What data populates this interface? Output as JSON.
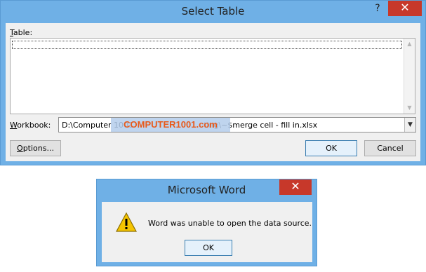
{
  "select_table": {
    "title": "Select Table",
    "help_glyph": "?",
    "close_glyph": "✕",
    "table_label_accel": "T",
    "table_label_rest": "able:",
    "workbook_label_accel": "W",
    "workbook_label_rest": "orkbook:",
    "workbook_value_start": "D:\\Computer 1001",
    "workbook_value_end": "ting\\~$merge cell - fill in.xlsx",
    "watermark": "COMPUTER1001.com",
    "options_label_accel": "O",
    "options_label_rest": "ptions...",
    "ok_label": "OK",
    "cancel_label": "Cancel"
  },
  "word_dialog": {
    "title": "Microsoft Word",
    "close_glyph": "✕",
    "message": "Word was unable to open the data source.",
    "ok_label": "OK"
  },
  "icons": {
    "warning": "warning-icon",
    "scroll_up": "chevron-up-icon",
    "scroll_down": "chevron-down-icon",
    "combo_arrow": "chevron-down-icon"
  },
  "colors": {
    "title_bar": "#6fb0e6",
    "close_button": "#c7382a",
    "client_bg": "#f0f0f0",
    "watermark_text": "#e85a1b"
  }
}
